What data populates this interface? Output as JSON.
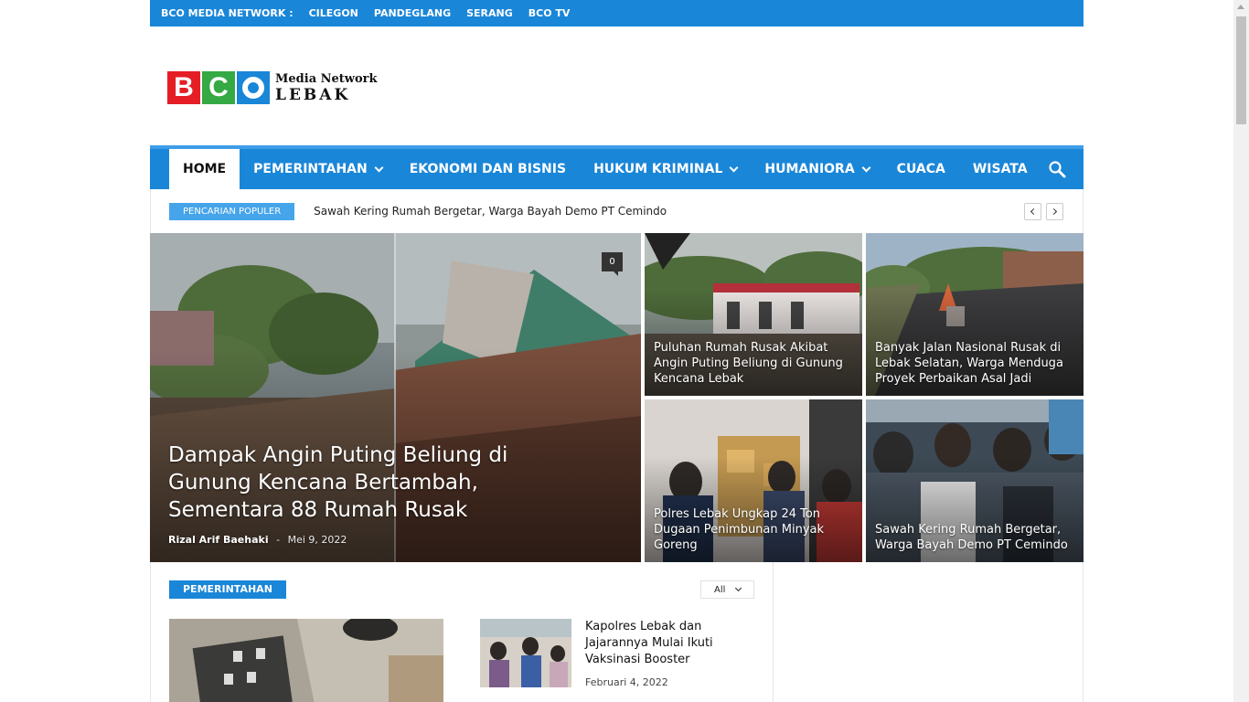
{
  "topbar": {
    "items": [
      "BCO MEDIA NETWORK :",
      "CILEGON",
      "PANDEGLANG",
      "SERANG",
      "BCO TV"
    ]
  },
  "logo": {
    "letters": [
      "B",
      "C",
      "O"
    ],
    "line1": "Media Network",
    "line2": "LEBAK"
  },
  "nav": {
    "items": [
      {
        "label": "HOME",
        "dropdown": false,
        "active": true
      },
      {
        "label": "PEMERINTAHAN",
        "dropdown": true
      },
      {
        "label": "EKONOMI DAN BISNIS",
        "dropdown": false
      },
      {
        "label": "HUKUM KRIMINAL",
        "dropdown": true
      },
      {
        "label": "HUMANIORA",
        "dropdown": true
      },
      {
        "label": "CUACA",
        "dropdown": false
      },
      {
        "label": "WISATA",
        "dropdown": false
      }
    ],
    "search_icon": "search-icon"
  },
  "ticker": {
    "badge": "PENCARIAN POPULER",
    "headline": "Sawah Kering Rumah Bergetar, Warga Bayah Demo PT Cemindo"
  },
  "featured": {
    "main": {
      "title": "Dampak Angin Puting Beliung di Gunung Kencana Bertambah, Sementara 88 Rumah Rusak",
      "author": "Rizal Arif Baehaki",
      "separator": "-",
      "date": "Mei 9, 2022",
      "comments": "0"
    },
    "tiles": [
      {
        "title": "Puluhan Rumah Rusak Akibat Angin Puting Beliung di Gunung Kencana Lebak"
      },
      {
        "title": "Banyak Jalan Nasional Rusak di Lebak Selatan, Warga Menduga Proyek Perbaikan Asal Jadi"
      },
      {
        "title": "Polres Lebak Ungkap 24 Ton Dugaan Penimbunan Minyak Goreng"
      },
      {
        "title": "Sawah Kering Rumah Bergetar, Warga Bayah Demo PT Cemindo"
      }
    ]
  },
  "section": {
    "category": "PEMERINTAHAN",
    "filter": "All",
    "side_post": {
      "title": "Kapolres Lebak dan Jajarannya Mulai Ikuti Vaksinasi Booster",
      "date": "Februari 4, 2022"
    }
  },
  "colors": {
    "brand_blue": "#1a86d8",
    "logo_red": "#e51e25",
    "logo_green": "#35a943"
  }
}
